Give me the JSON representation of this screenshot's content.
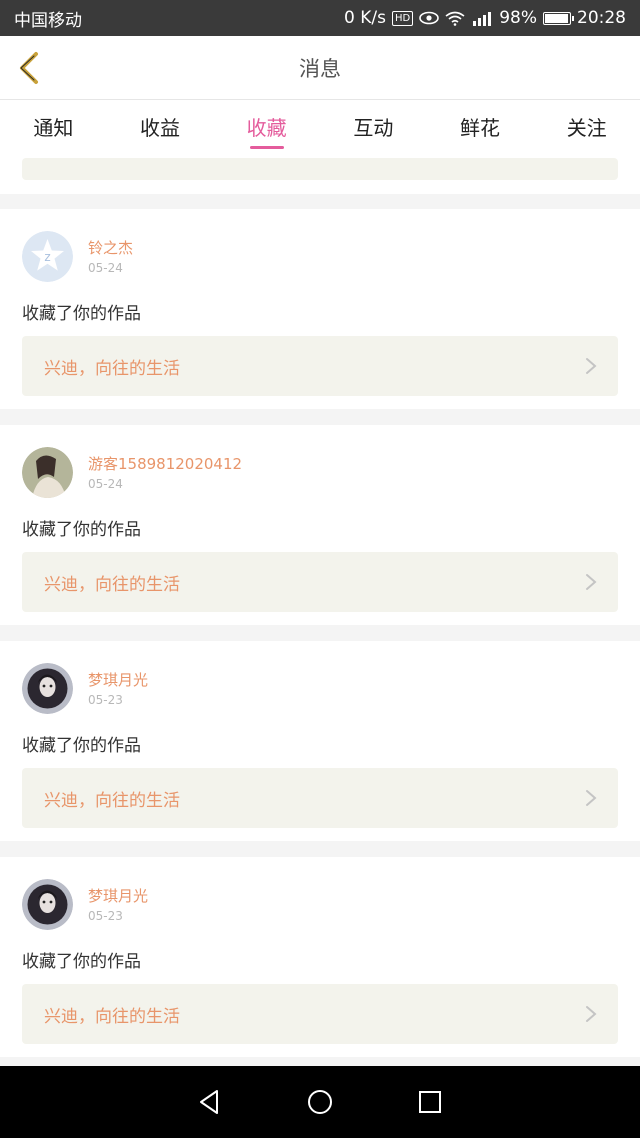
{
  "status_bar": {
    "carrier": "中国移动",
    "speed": "0 K/s",
    "hd": "HD",
    "battery": "98%",
    "battery_level": 0.98,
    "time": "20:28"
  },
  "header": {
    "title": "消息"
  },
  "tabs": [
    {
      "label": "通知",
      "active": false
    },
    {
      "label": "收益",
      "active": false
    },
    {
      "label": "收藏",
      "active": true
    },
    {
      "label": "互动",
      "active": false
    },
    {
      "label": "鲜花",
      "active": false
    },
    {
      "label": "关注",
      "active": false
    }
  ],
  "messages": [
    {
      "user": "铃之杰",
      "date": "05-24",
      "action": "收藏了你的作品",
      "work_title": "兴迪，向往的生活"
    },
    {
      "user": "游客1589812020412",
      "date": "05-24",
      "action": "收藏了你的作品",
      "work_title": "兴迪，向往的生活"
    },
    {
      "user": "梦琪月光",
      "date": "05-23",
      "action": "收藏了你的作品",
      "work_title": "兴迪，向往的生活"
    },
    {
      "user": "梦琪月光",
      "date": "05-23",
      "action": "收藏了你的作品",
      "work_title": "兴迪，向往的生活"
    }
  ],
  "colors": {
    "accent": "#e45c9c",
    "username": "#e8956a",
    "work_bg": "#f3f3ec"
  }
}
